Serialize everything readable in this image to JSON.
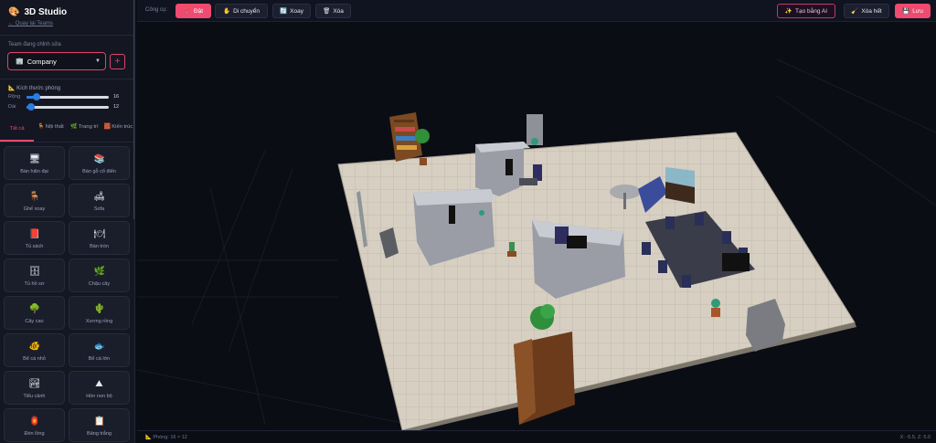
{
  "app": {
    "title": "3D Studio",
    "back_link": "← Quay lại Teams"
  },
  "team": {
    "label": "Team đang chỉnh sửa",
    "selected": "Company",
    "add_label": "+"
  },
  "room_size": {
    "title": "Kích thước phòng",
    "width_label": "Rộng",
    "width_value": "16",
    "width_fraction": 0.12,
    "length_label": "Dài",
    "length_value": "12",
    "length_fraction": 0.06
  },
  "tabs": [
    {
      "label": "Tất cả",
      "icon": "",
      "active": true
    },
    {
      "label": "Nội thất",
      "icon": "chair-icon",
      "active": false
    },
    {
      "label": "Trang trí",
      "icon": "leaf-icon",
      "active": false
    },
    {
      "label": "Kiến trúc",
      "icon": "brick-icon",
      "active": false
    }
  ],
  "items": [
    {
      "label": "Bàn hiện đại",
      "icon": "monitor-desk-icon",
      "glyph": "🖥"
    },
    {
      "label": "Bàn gỗ cổ điển",
      "icon": "books-icon",
      "glyph": "📚"
    },
    {
      "label": "Ghế xoay",
      "icon": "chair-icon",
      "glyph": "🪑"
    },
    {
      "label": "Sofa",
      "icon": "sofa-icon",
      "glyph": "🛋"
    },
    {
      "label": "Tủ sách",
      "icon": "book-icon",
      "glyph": "📕"
    },
    {
      "label": "Bàn tròn",
      "icon": "plate-icon",
      "glyph": "🍽"
    },
    {
      "label": "Tủ hồ sơ",
      "icon": "cabinet-icon",
      "glyph": "🗄"
    },
    {
      "label": "Chậu cây",
      "icon": "herb-icon",
      "glyph": "🌿"
    },
    {
      "label": "Cây cao",
      "icon": "tree-icon",
      "glyph": "🌳"
    },
    {
      "label": "Xương rồng",
      "icon": "cactus-icon",
      "glyph": "🌵"
    },
    {
      "label": "Bể cá nhỏ",
      "icon": "fish-icon",
      "glyph": "🐠"
    },
    {
      "label": "Bể cá lớn",
      "icon": "fish-icon",
      "glyph": "🐟"
    },
    {
      "label": "Tiểu cảnh",
      "icon": "landscape-icon",
      "glyph": "🏞"
    },
    {
      "label": "Hòn non bộ",
      "icon": "rock-icon",
      "glyph": "⛰"
    },
    {
      "label": "Đèn lồng",
      "icon": "lantern-icon",
      "glyph": "🏮"
    },
    {
      "label": "Bảng trắng",
      "icon": "clipboard-icon",
      "glyph": "📋"
    }
  ],
  "toolbar": {
    "label": "Công cụ:",
    "place": "Đặt",
    "move": "Di chuyển",
    "rotate": "Xoay",
    "delete": "Xóa",
    "ai": "Tạo bằng AI",
    "clear": "Xóa hết",
    "save": "Lưu"
  },
  "status": {
    "room": "Phòng: 16 × 12",
    "coords": "X: -5.5, Z: 5.0"
  },
  "colors": {
    "accent": "#ef4a6f",
    "floor": "#d6cfc2",
    "slider": "#2a7de1"
  }
}
